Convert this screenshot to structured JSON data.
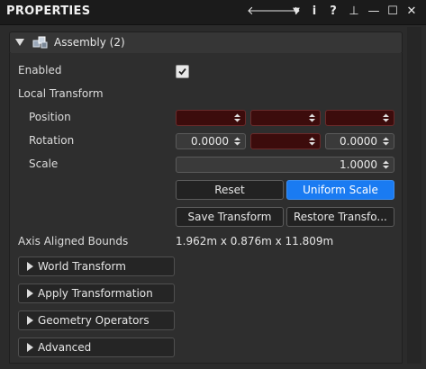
{
  "window": {
    "title": "PROPERTIES",
    "toolbar_icons": [
      "arrow-left-icon",
      "arrow-right-icon",
      "dropdown-icon",
      "info-icon",
      "help-icon",
      "pin-icon",
      "minimize-icon",
      "maximize-icon",
      "close-icon"
    ],
    "glyphs": {
      "back": "🡐",
      "forward": "🡒",
      "menu": "▼",
      "info": "i",
      "help": "?",
      "pin": "⊥",
      "minimize": "—",
      "maximize": "☐",
      "close": "✕"
    }
  },
  "section": {
    "title": "Assembly (2)",
    "expanded": true
  },
  "fields": {
    "enabled_label": "Enabled",
    "enabled_checked": true,
    "local_transform_label": "Local Transform",
    "position_label": "Position",
    "rotation_label": "Rotation",
    "scale_label": "Scale",
    "position": [
      "",
      "",
      ""
    ],
    "rotation": [
      "0.0000",
      "",
      "0.0000"
    ],
    "scale": "1.0000"
  },
  "buttons": {
    "reset": "Reset",
    "uniform_scale": "Uniform Scale",
    "save_transform": "Save Transform",
    "restore_transform": "Restore Transfo..."
  },
  "bounds": {
    "label": "Axis Aligned Bounds",
    "value": "1.962m x 0.876m x 11.809m"
  },
  "collapsibles": [
    "World Transform",
    "Apply Transformation",
    "Geometry Operators",
    "Advanced"
  ],
  "colors": {
    "accent": "#1a7bf2",
    "mixed_value_bg": "#3c0c0c"
  }
}
